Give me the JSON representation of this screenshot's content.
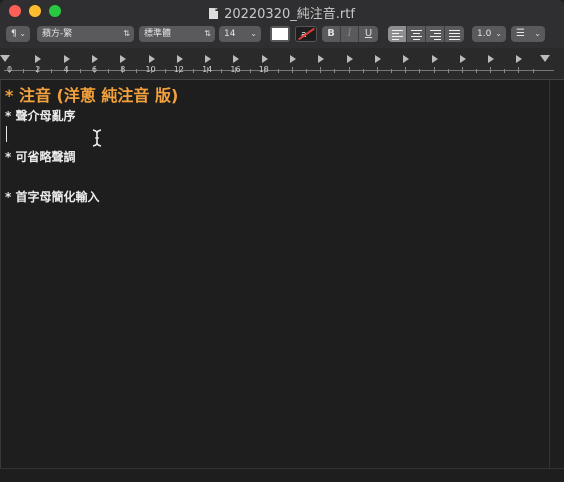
{
  "window": {
    "title": "20220320_純注音.rtf"
  },
  "toolbar": {
    "paragraph_style": "¶",
    "font_family": "蘋方-繁",
    "typeface": "標準體",
    "font_size": "14",
    "bold_label": "B",
    "italic_label": "I",
    "underline_label": "U",
    "line_spacing": "1.0",
    "text_color": "#ffffff",
    "bg_color": "#1e1e1e"
  },
  "ruler": {
    "numbers": [
      "0",
      "2",
      "4",
      "6",
      "8",
      "10",
      "12",
      "14",
      "16",
      "18"
    ]
  },
  "document": {
    "heading": "* 注音 (洋蔥 純注音 版)",
    "lines": [
      "* 聲介母亂序",
      "* 可省略聲調",
      "* 首字母簡化輸入"
    ]
  },
  "colors": {
    "heading": "#f3a13c",
    "body": "#ececec",
    "background": "#1e1e1e"
  }
}
